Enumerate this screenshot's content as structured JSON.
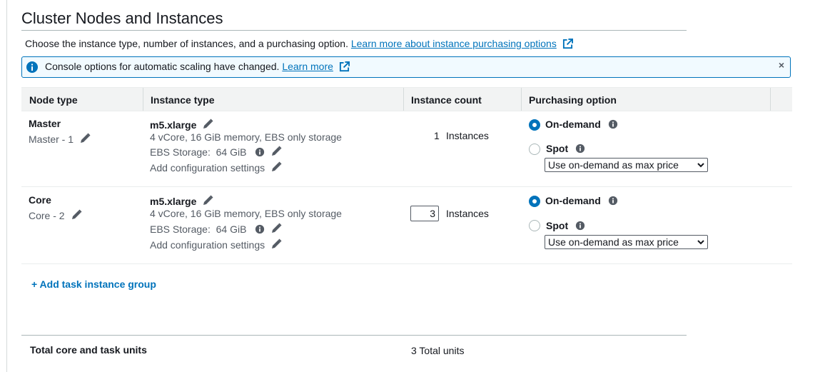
{
  "section": {
    "title": "Cluster Nodes and Instances",
    "description": "Choose the instance type, number of instances, and a purchasing option.",
    "learn_more_purchasing": "Learn more about instance purchasing options"
  },
  "banner": {
    "message": "Console options for automatic scaling have changed.",
    "learn_more": "Learn more",
    "close": "×"
  },
  "table": {
    "headers": [
      "Node type",
      "Instance type",
      "Instance count",
      "Purchasing option"
    ],
    "rows": [
      {
        "node_type": "Master",
        "node_name": "Master - 1",
        "instance_type": "m5.xlarge",
        "specs": "4 vCore, 16 GiB memory, EBS only storage",
        "ebs_label": "EBS Storage:",
        "ebs_value": "64 GiB",
        "add_config": "Add configuration settings",
        "count": "1",
        "count_unit": "Instances",
        "ondemand_label": "On-demand",
        "spot_label": "Spot",
        "selected_option": "On-demand",
        "max_price": "Use on-demand as max price"
      },
      {
        "node_type": "Core",
        "node_name": "Core - 2",
        "instance_type": "m5.xlarge",
        "specs": "4 vCore, 16 GiB memory, EBS only storage",
        "ebs_label": "EBS Storage:",
        "ebs_value": "64 GiB",
        "add_config": "Add configuration settings",
        "count": "3",
        "count_unit": "Instances",
        "ondemand_label": "On-demand",
        "spot_label": "Spot",
        "selected_option": "On-demand",
        "max_price": "Use on-demand as max price"
      }
    ]
  },
  "add_task_group": "+ Add task instance group",
  "totals": {
    "label": "Total core and task units",
    "value": "3 Total units"
  },
  "colors": {
    "link": "#0073bb",
    "banner_border": "#0073bb",
    "banner_bg": "#f1faff",
    "header_bg": "#f2f3f3"
  }
}
